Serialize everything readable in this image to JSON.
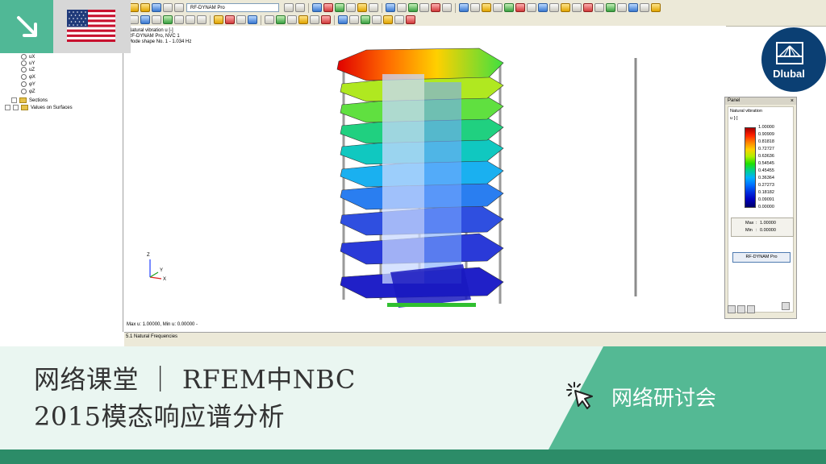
{
  "toolbar": {
    "module_name": "RF-DYNAM Pro"
  },
  "navigator": {
    "items": [
      {
        "label": "uX"
      },
      {
        "label": "uY"
      },
      {
        "label": "uZ"
      },
      {
        "label": "φX"
      },
      {
        "label": "φY"
      },
      {
        "label": "φZ"
      },
      {
        "label": "Sections"
      },
      {
        "label": "Values on Surfaces"
      }
    ]
  },
  "viewport": {
    "info_line1": "Natural vibration u [-]",
    "info_line2": "RF-DYNAM Pro, NVC 1",
    "info_line3": "Mode shape No. 1 - 1.034 Hz",
    "max_min_line": "Max u: 1.00000, Min u: 0.00000 -",
    "axis_z": "Z",
    "axis_x": "X",
    "axis_y": "Y"
  },
  "panel": {
    "title": "Panel",
    "close": "×",
    "heading": "Natural vibration",
    "unit": "u [-]",
    "legend_values": [
      "1.00000",
      "0.90909",
      "0.81818",
      "0.72727",
      "0.63636",
      "0.54545",
      "0.45455",
      "0.36364",
      "0.27273",
      "0.18182",
      "0.09091",
      "0.00000"
    ],
    "max_label": "Max",
    "max_value": "1.00000",
    "min_label": "Min",
    "min_value": "0.00000",
    "button_label": "RF-DYNAM Pro"
  },
  "results": {
    "title": "5.1 Natural Frequencies"
  },
  "overlay": {
    "logo_text": "Dlubal",
    "course_line1": "网络课堂 ｜ RFEM中NBC",
    "course_line2": "2015模态响应谱分析",
    "webinar_label": "网络研讨会",
    "colors": {
      "brand_green": "#54b994",
      "dark_green": "#2c8c68",
      "dlubal_blue": "#0b3f73"
    }
  }
}
